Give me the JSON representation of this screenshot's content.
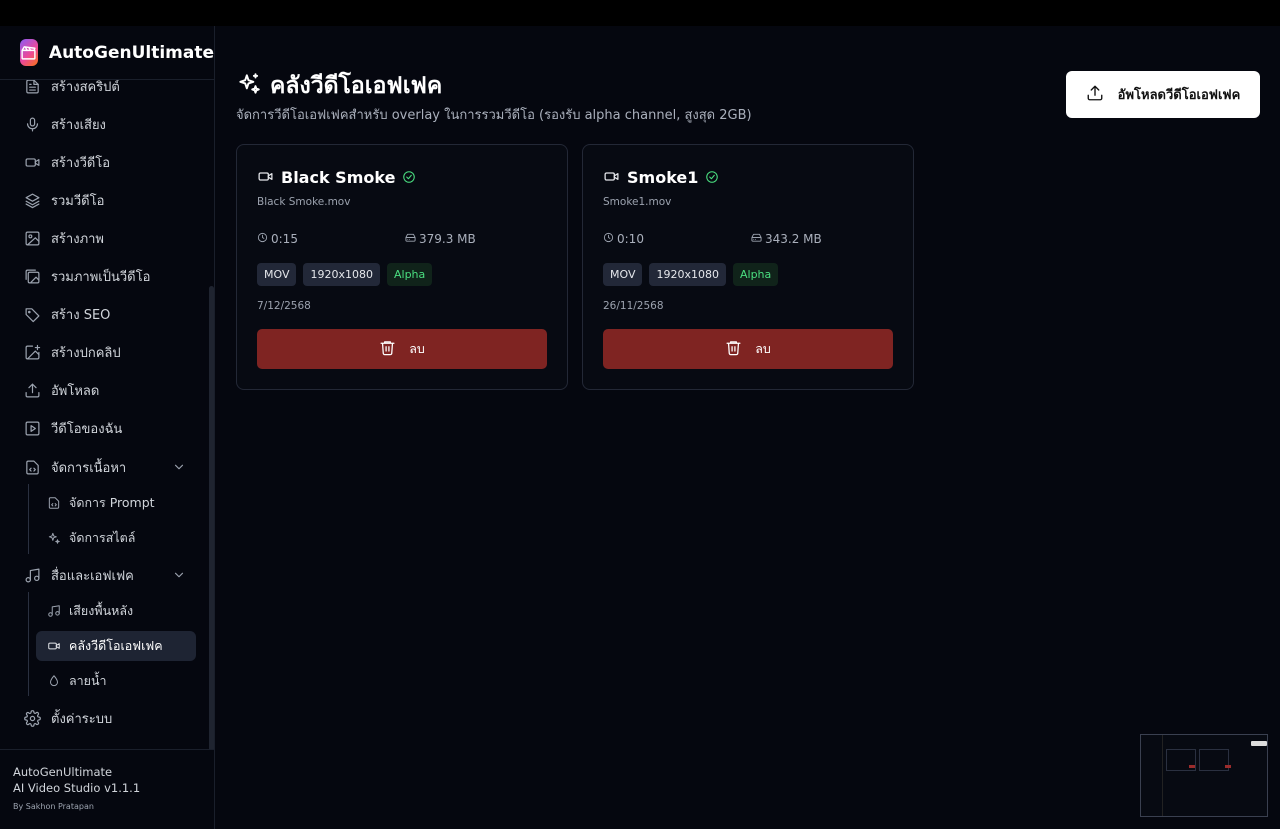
{
  "app": {
    "name": "AutoGenUltimate"
  },
  "sidebar": {
    "items": [
      {
        "label": "สร้างสคริปต์",
        "icon": "document-icon"
      },
      {
        "label": "สร้างเสียง",
        "icon": "microphone-icon"
      },
      {
        "label": "สร้างวีดีโอ",
        "icon": "video-icon"
      },
      {
        "label": "รวมวีดีโอ",
        "icon": "layers-icon"
      },
      {
        "label": "สร้างภาพ",
        "icon": "image-icon"
      },
      {
        "label": "รวมภาพเป็นวีดีโอ",
        "icon": "images-icon"
      },
      {
        "label": "สร้าง SEO",
        "icon": "tag-icon"
      },
      {
        "label": "สร้างปกคลิป",
        "icon": "image-plus-icon"
      },
      {
        "label": "อัพโหลด",
        "icon": "upload-icon"
      },
      {
        "label": "วีดีโอของฉัน",
        "icon": "play-square-icon"
      }
    ],
    "groups": [
      {
        "label": "จัดการเนื้อหา",
        "icon": "file-code-icon",
        "children": [
          {
            "label": "จัดการ Prompt",
            "icon": "file-code-icon"
          },
          {
            "label": "จัดการสไตล์",
            "icon": "sparkles-icon"
          }
        ]
      },
      {
        "label": "สื่อและเอฟเฟค",
        "icon": "music-icon",
        "children": [
          {
            "label": "เสียงพื้นหลัง",
            "icon": "music-icon"
          },
          {
            "label": "คลังวีดีโอเอฟเฟค",
            "icon": "video-icon",
            "active": true
          },
          {
            "label": "ลายน้ำ",
            "icon": "droplet-icon"
          }
        ]
      }
    ],
    "settings": {
      "label": "ตั้งค่าระบบ",
      "icon": "gear-icon"
    },
    "footer": {
      "name": "AutoGenUltimate",
      "version": "AI Video Studio v1.1.1",
      "author": "By Sakhon Pratapan"
    }
  },
  "page": {
    "title": "คลังวีดีโอเอฟเฟค",
    "subtitle": "จัดการวีดีโอเอฟเฟคสำหรับ overlay ในการรวมวีดีโอ (รองรับ alpha channel, สูงสุด 2GB)",
    "upload_label": "อัพโหลดวีดีโอเอฟเฟค"
  },
  "effects": [
    {
      "name": "Black Smoke",
      "file": "Black Smoke.mov",
      "duration": "0:15",
      "size": "379.3 MB",
      "tags": [
        "MOV",
        "1920x1080",
        "Alpha"
      ],
      "date": "7/12/2568",
      "delete_label": "ลบ"
    },
    {
      "name": "Smoke1",
      "file": "Smoke1.mov",
      "duration": "0:10",
      "size": "343.2 MB",
      "tags": [
        "MOV",
        "1920x1080",
        "Alpha"
      ],
      "date": "26/11/2568",
      "delete_label": "ลบ"
    }
  ],
  "colors": {
    "background": "#05070f",
    "danger": "#7f2422",
    "success": "#4ade80",
    "accent_logo": "#8b5cf6"
  }
}
